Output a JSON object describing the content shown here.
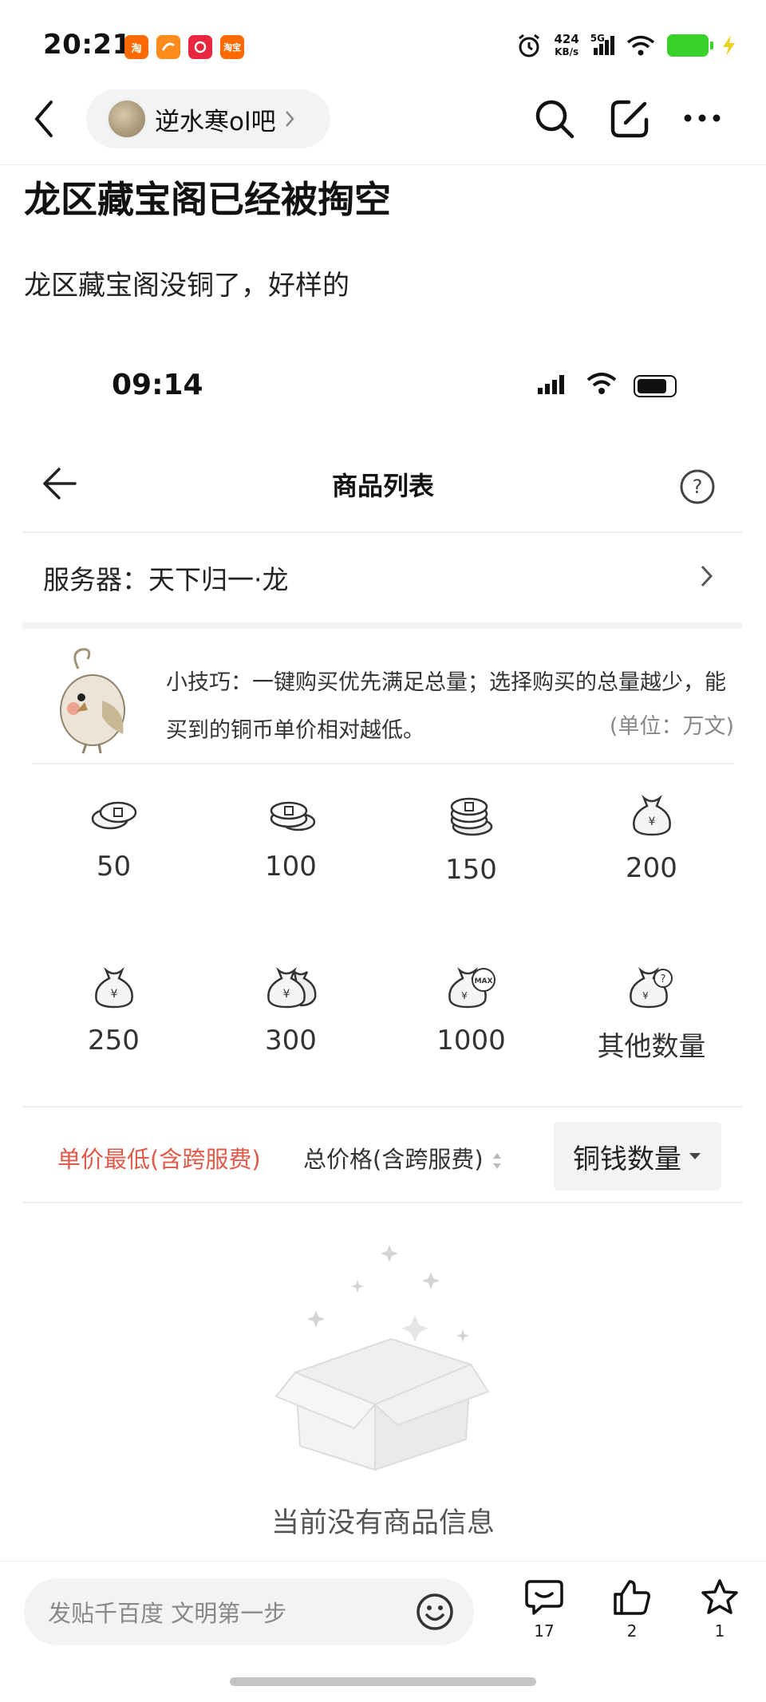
{
  "status_bar": {
    "time": "20:21",
    "apps": [
      {
        "icon": "taobao-icon",
        "text": "淘",
        "color": "#ff6a00"
      },
      {
        "icon": "app-orange-icon",
        "text": "",
        "color": "#ff8c1a"
      },
      {
        "icon": "app-red-icon",
        "text": "",
        "color": "#e8273f"
      },
      {
        "icon": "taobao-flash-icon",
        "text": "淘宝",
        "color": "#ff6a00"
      }
    ],
    "speed_value": "424",
    "speed_unit": "KB/s",
    "network": "5G",
    "battery_color": "#3ad12a"
  },
  "forum": {
    "name": "逆水寒ol吧"
  },
  "post": {
    "title": "龙区藏宝阁已经被掏空",
    "body": "龙区藏宝阁没铜了，好样的"
  },
  "screenshot": {
    "time": "09:14",
    "page_title": "商品列表",
    "server_label": "服务器：",
    "server_value": "天下归一·龙",
    "tip": "小技巧：一键购买优先满足总量；选择购买的总量越少，能买到的铜币单价相对越低。",
    "unit": "(单位：万文)",
    "amounts": [
      {
        "label": "50",
        "icon": "coins-small-icon"
      },
      {
        "label": "100",
        "icon": "coins-stack-icon"
      },
      {
        "label": "150",
        "icon": "coins-pile-icon"
      },
      {
        "label": "200",
        "icon": "money-bag-icon"
      },
      {
        "label": "250",
        "icon": "money-bag-icon"
      },
      {
        "label": "300",
        "icon": "money-bags-icon"
      },
      {
        "label": "1000",
        "icon": "money-bag-max-icon"
      },
      {
        "label": "其他数量",
        "icon": "money-bag-question-icon"
      }
    ],
    "sort": {
      "unit_price": "单价最低(含跨服费)",
      "total_price": "总价格(含跨服费)",
      "coin_amount": "铜钱数量"
    },
    "empty_text": "当前没有商品信息",
    "accent_color": "#e05a4a"
  },
  "bottom_bar": {
    "reply_placeholder": "发贴千百度 文明第一步",
    "comments": "17",
    "likes": "2",
    "favorites": "1"
  }
}
